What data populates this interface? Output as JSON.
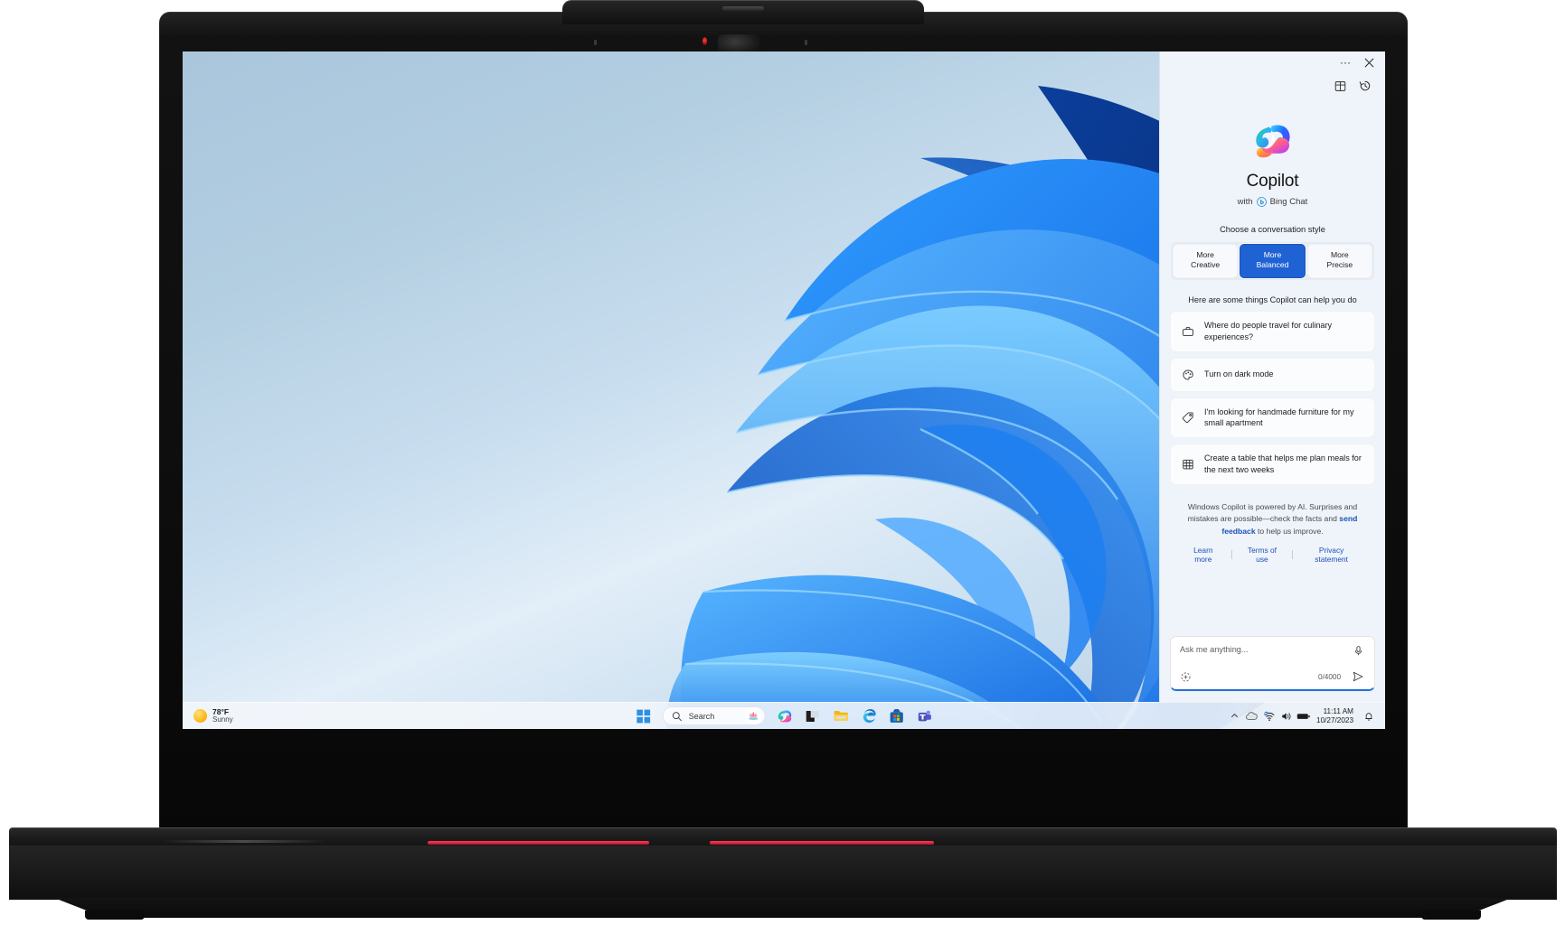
{
  "device": {
    "brand": "ThinkPad-style laptop",
    "camera": "webcam"
  },
  "desktop": {
    "wallpaper_name": "Windows 11 Bloom"
  },
  "taskbar": {
    "weather": {
      "temperature": "78°F",
      "condition": "Sunny",
      "icon": "sun-icon"
    },
    "start_label": "Start",
    "search": {
      "placeholder": "Search",
      "value": "",
      "icon": "search-icon",
      "badge_icon": "lotus-icon"
    },
    "apps": [
      {
        "name": "copilot",
        "label": "Copilot"
      },
      {
        "name": "file-explorer-dark",
        "label": "File Explorer"
      },
      {
        "name": "folder",
        "label": "File Explorer"
      },
      {
        "name": "edge",
        "label": "Microsoft Edge"
      },
      {
        "name": "microsoft-store",
        "label": "Microsoft Store"
      },
      {
        "name": "teams",
        "label": "Microsoft Teams"
      }
    ],
    "tray": {
      "chevron_label": "Show hidden icons",
      "icons": [
        "onedrive-icon",
        "network-icon",
        "volume-icon",
        "battery-icon"
      ],
      "time": "11:11 AM",
      "date": "10/27/2023",
      "notifications_icon": "bell-icon"
    }
  },
  "copilot": {
    "titlebar": {
      "more_label": "···",
      "close_label": "✕"
    },
    "toolbar": {
      "plugins_label": "Plugins",
      "history_label": "Recent activity"
    },
    "title": "Copilot",
    "subtitle_prefix": "with",
    "subtitle_brand": "Bing Chat",
    "style_label": "Choose a conversation style",
    "styles": [
      {
        "line1": "More",
        "line2": "Creative",
        "active": false
      },
      {
        "line1": "More",
        "line2": "Balanced",
        "active": true
      },
      {
        "line1": "More",
        "line2": "Precise",
        "active": false
      }
    ],
    "active_style_color": "#1f62d4",
    "help_heading": "Here are some things Copilot can help you do",
    "suggestions": [
      {
        "icon": "briefcase-icon",
        "text": "Where do people travel for culinary experiences?"
      },
      {
        "icon": "palette-icon",
        "text": "Turn on dark mode"
      },
      {
        "icon": "tag-icon",
        "text": "I'm looking for handmade furniture for my small apartment"
      },
      {
        "icon": "table-icon",
        "text": "Create a table that helps me plan meals for the next two weeks"
      }
    ],
    "disclaimer": {
      "part1": "Windows Copilot is powered by AI. Surprises and mistakes are possible—check the facts and ",
      "link": "send feedback",
      "part2": " to help us improve."
    },
    "links": [
      "Learn more",
      "Terms of use",
      "Privacy statement"
    ],
    "link_color": "#1c52b5",
    "compose": {
      "placeholder": "Ask me anything...",
      "value": "",
      "counter": "0/4000",
      "mic_label": "Use microphone",
      "plugin_label": "Plugins",
      "send_label": "Submit"
    }
  }
}
